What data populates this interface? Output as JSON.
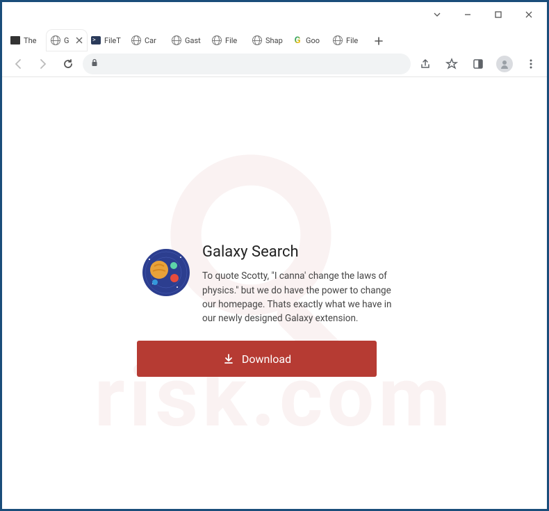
{
  "tabs": [
    {
      "title": "The",
      "icon": "printer"
    },
    {
      "title": "G",
      "icon": "globe",
      "active": true
    },
    {
      "title": "FileT",
      "icon": "terminal"
    },
    {
      "title": "Car",
      "icon": "globe"
    },
    {
      "title": "Gast",
      "icon": "globe"
    },
    {
      "title": "File",
      "icon": "globe"
    },
    {
      "title": "Shap",
      "icon": "globe"
    },
    {
      "title": "Goo",
      "icon": "google"
    },
    {
      "title": "File",
      "icon": "globe"
    }
  ],
  "page": {
    "title": "Galaxy Search",
    "description": "To quote Scotty, \"I canna' change the laws of physics.\" but we do have the power to change our homepage. Thats exactly what we have in our newly designed Galaxy extension.",
    "button_label": "Download"
  },
  "watermark_text": "risk.com"
}
